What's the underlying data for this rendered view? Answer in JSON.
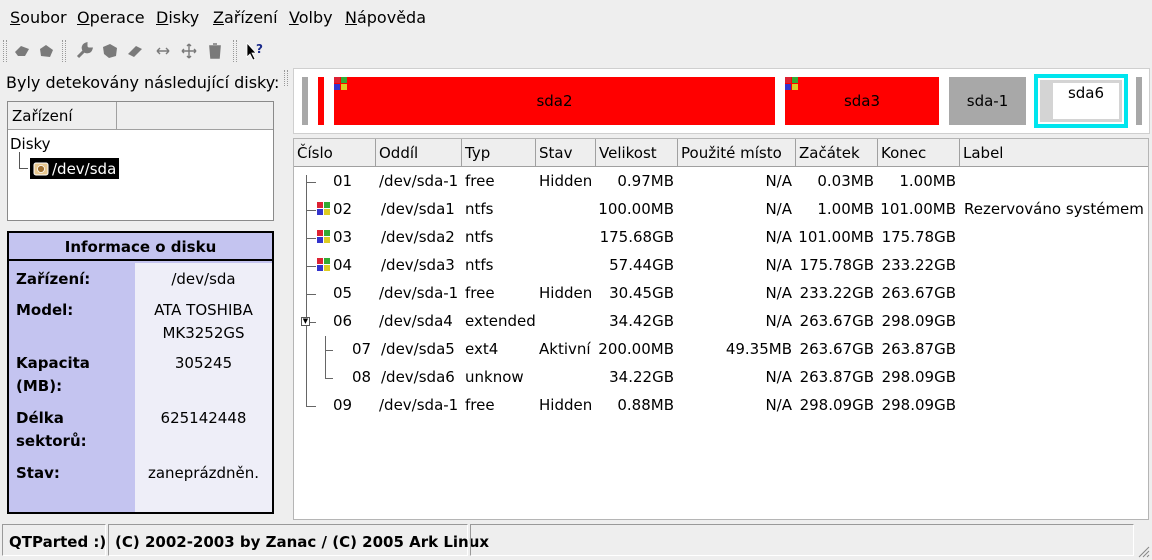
{
  "menu": {
    "items": [
      {
        "mnemonic": "S",
        "rest": "oubor"
      },
      {
        "mnemonic": "O",
        "rest": "perace"
      },
      {
        "mnemonic": "D",
        "rest": "isky"
      },
      {
        "mnemonic": "Z",
        "rest": "ařízení"
      },
      {
        "mnemonic": "V",
        "rest": "olby"
      },
      {
        "mnemonic": "N",
        "rest": "ápověda"
      }
    ]
  },
  "toolbar": {
    "icons": [
      "undo-icon",
      "commit-icon",
      "wrench-icon",
      "format-icon",
      "eraser-icon",
      "resize-icon",
      "move-icon",
      "delete-icon",
      "whats-this-icon"
    ]
  },
  "left": {
    "detected_label": "Byly detekovány následující disky:",
    "tree_header": "Zařízení",
    "tree_root": "Disky",
    "tree_device": "/dev/sda"
  },
  "disk_info": {
    "title": "Informace o disku",
    "rows": [
      {
        "label": "Zařízení:",
        "value": "/dev/sda"
      },
      {
        "label": "Model:",
        "value": "ATA TOSHIBA MK3252GS"
      },
      {
        "label": "Kapacita (MB):",
        "value": "305245"
      },
      {
        "label": "Délka sektorů:",
        "value": "625142448"
      },
      {
        "label": "Stav:",
        "value": "zaneprázdněn."
      }
    ]
  },
  "partition_map": {
    "blocks": [
      "sda2",
      "sda3",
      "sda-1",
      "sda6"
    ],
    "colors": {
      "ntfs": "#ff0000",
      "free": "#a8a8a8",
      "selected": "#00e5ee",
      "ext4": "#ffffff"
    }
  },
  "table": {
    "headers": [
      "Číslo",
      "Oddíl",
      "Typ",
      "Stav",
      "Velikost",
      "Použité místo",
      "Začátek",
      "Konec",
      "Label"
    ],
    "rows": [
      [
        "01",
        "/dev/sda-1",
        "free",
        "Hidden",
        "0.97MB",
        "N/A",
        "0.03MB",
        "1.00MB",
        ""
      ],
      [
        "02",
        "/dev/sda1",
        "ntfs",
        "",
        "100.00MB",
        "N/A",
        "1.00MB",
        "101.00MB",
        "Rezervováno systémem"
      ],
      [
        "03",
        "/dev/sda2",
        "ntfs",
        "",
        "175.68GB",
        "N/A",
        "101.00MB",
        "175.78GB",
        ""
      ],
      [
        "04",
        "/dev/sda3",
        "ntfs",
        "",
        "57.44GB",
        "N/A",
        "175.78GB",
        "233.22GB",
        ""
      ],
      [
        "05",
        "/dev/sda-1",
        "free",
        "Hidden",
        "30.45GB",
        "N/A",
        "233.22GB",
        "263.67GB",
        ""
      ],
      [
        "06",
        "/dev/sda4",
        "extended",
        "",
        "34.42GB",
        "N/A",
        "263.67GB",
        "298.09GB",
        ""
      ],
      [
        "07",
        "/dev/sda5",
        "ext4",
        "Aktivní",
        "200.00MB",
        "49.35MB",
        "263.67GB",
        "263.87GB",
        ""
      ],
      [
        "08",
        "/dev/sda6",
        "unknow",
        "",
        "34.22GB",
        "N/A",
        "263.87GB",
        "298.09GB",
        ""
      ],
      [
        "09",
        "/dev/sda-1",
        "free",
        "Hidden",
        "0.88MB",
        "N/A",
        "298.09GB",
        "298.09GB",
        ""
      ]
    ]
  },
  "status": {
    "app": "QTParted :)",
    "copyright": "(C) 2002-2003 by Zanac / (C) 2005 Ark Linux"
  }
}
